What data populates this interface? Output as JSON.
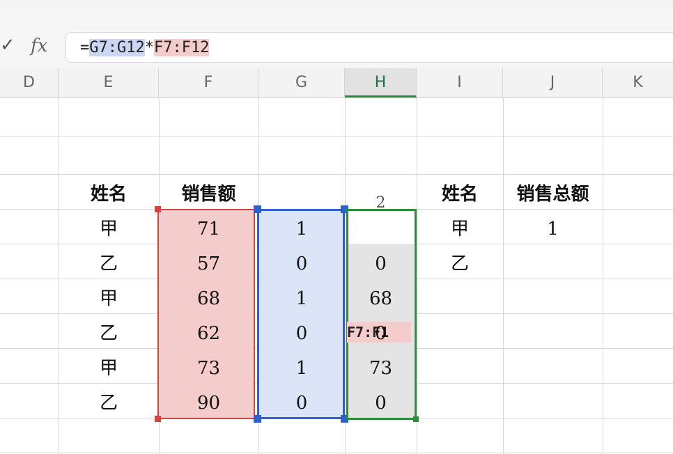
{
  "formula_bar": {
    "check_glyph": "✓",
    "fx_label": "fx",
    "formula_prefix": "=",
    "formula_ref_g": "G7:G12",
    "formula_op": "*",
    "formula_ref_f": "F7:F12"
  },
  "columns": [
    "D",
    "E",
    "F",
    "G",
    "H",
    "I",
    "J",
    "K"
  ],
  "selected_column": "H",
  "table": {
    "header_name": "姓名",
    "header_sales": "销售额",
    "rows": [
      {
        "name": "甲",
        "sales": "71",
        "flag": "1",
        "result": ""
      },
      {
        "name": "乙",
        "sales": "57",
        "flag": "0",
        "result": "0"
      },
      {
        "name": "甲",
        "sales": "68",
        "flag": "1",
        "result": "68"
      },
      {
        "name": "乙",
        "sales": "62",
        "flag": "0",
        "result": "0"
      },
      {
        "name": "甲",
        "sales": "73",
        "flag": "1",
        "result": "73"
      },
      {
        "name": "乙",
        "sales": "90",
        "flag": "0",
        "result": "0"
      }
    ],
    "h_top_partial": "2",
    "h_inline_ref": "F7:F1"
  },
  "summary": {
    "header_name": "姓名",
    "header_total": "销售总额",
    "rows": [
      {
        "name": "甲",
        "total": "1"
      },
      {
        "name": "乙",
        "total": ""
      }
    ]
  },
  "colors": {
    "accent_green": "#2e8b4a",
    "range_red": "#d24545",
    "range_blue": "#2f5fcb"
  }
}
